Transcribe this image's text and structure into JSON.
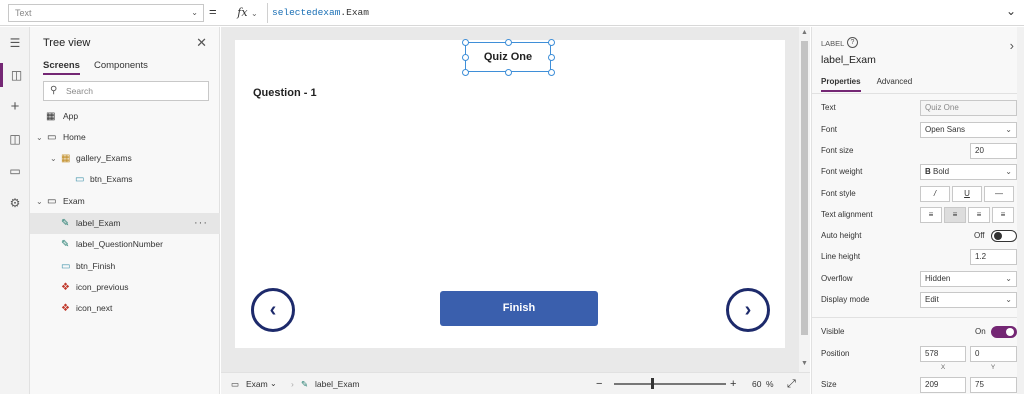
{
  "formula_bar": {
    "property": "Text",
    "equals": "=",
    "fx_label": "fx",
    "formula_object": "selectedexam",
    "formula_member": ".Exam"
  },
  "tree": {
    "title": "Tree view",
    "tabs": [
      "Screens",
      "Components"
    ],
    "search_placeholder": "Search",
    "rows": [
      {
        "label": "App",
        "kind": "app"
      },
      {
        "label": "Home",
        "kind": "screen"
      },
      {
        "label": "gallery_Exams",
        "kind": "gallery"
      },
      {
        "label": "btn_Exams",
        "kind": "button"
      },
      {
        "label": "Exam",
        "kind": "screen"
      },
      {
        "label": "label_Exam",
        "kind": "label",
        "selected": true,
        "more": "···"
      },
      {
        "label": "label_QuestionNumber",
        "kind": "label"
      },
      {
        "label": "btn_Finish",
        "kind": "button"
      },
      {
        "label": "icon_previous",
        "kind": "icon"
      },
      {
        "label": "icon_next",
        "kind": "icon"
      }
    ]
  },
  "canvas": {
    "title": "Quiz One",
    "question": "Question - 1",
    "finish": "Finish",
    "prev_glyph": "‹",
    "next_glyph": "›"
  },
  "status": {
    "screen": "Exam",
    "control": "label_Exam",
    "zoom_minus": "−",
    "zoom_plus": "+",
    "zoom_value": "60",
    "zoom_unit": "%"
  },
  "properties": {
    "kind": "LABEL",
    "name": "label_Exam",
    "tabs": [
      "Properties",
      "Advanced"
    ],
    "labels": {
      "text": "Text",
      "font": "Font",
      "font_size": "Font size",
      "font_weight": "Font weight",
      "font_style": "Font style",
      "text_alignment": "Text alignment",
      "auto_height": "Auto height",
      "line_height": "Line height",
      "overflow": "Overflow",
      "display_mode": "Display mode",
      "visible": "Visible",
      "position": "Position",
      "size": "Size"
    },
    "values": {
      "text": "Quiz One",
      "font": "Open Sans",
      "font_size": "20",
      "font_weight": "Bold",
      "font_weight_glyph": "B",
      "italic": "/",
      "underline": "U",
      "strike": "—",
      "auto_height": "Off",
      "line_height": "1.2",
      "overflow": "Hidden",
      "display_mode": "Edit",
      "visible": "On",
      "x": "578",
      "y": "0",
      "x_caption": "X",
      "y_caption": "Y",
      "width": "209",
      "height": "75"
    },
    "text_alignment_selected": "center"
  },
  "colors": {
    "accent": "#742774",
    "selection": "#3f8fd8",
    "button": "#3a5fad",
    "nav_icon": "#1d2a6b"
  }
}
